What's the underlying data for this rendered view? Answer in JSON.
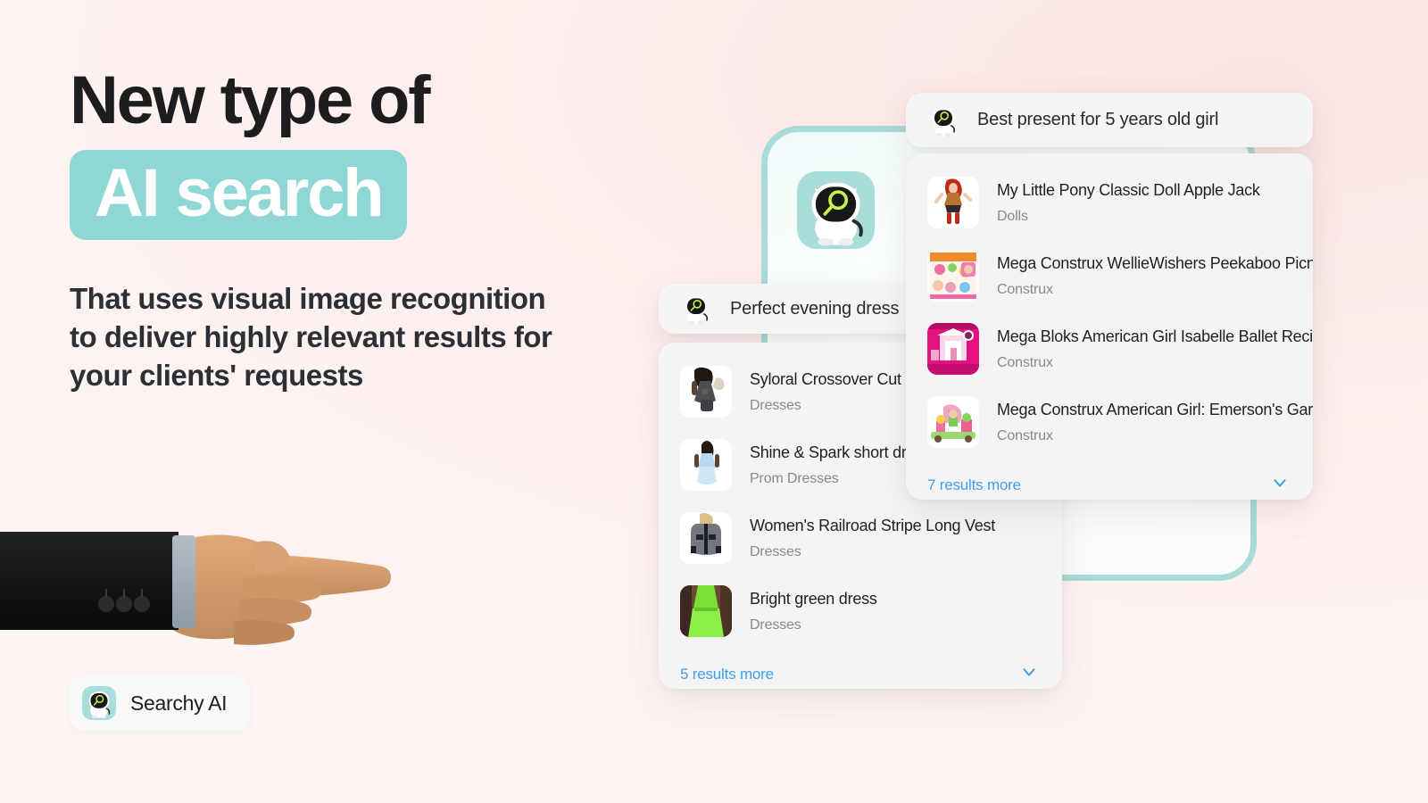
{
  "brand": {
    "name": "Searchy AI",
    "icon": "searchy-robot-icon",
    "accent_teal": "#a8ddd9",
    "accent_green": "#c6f04a",
    "background_pink": "#fdeceb"
  },
  "hero": {
    "headline_line1": "New type of",
    "headline_highlight": "AI search",
    "highlight_bg": "#8ed7d4",
    "subheadline": "That uses visual image recognition to deliver highly relevant results for your clients' requests",
    "pointer_icon": "pointing-hand-right-icon"
  },
  "cards": [
    {
      "id": "evening-dress",
      "query": "Perfect evening dress",
      "query_icon": "searchy-robot-icon",
      "results": [
        {
          "title": "Syloral Crossover Cut Out Fro",
          "category": "Dresses",
          "thumb": "thumbnail-sequin-dress"
        },
        {
          "title": "Shine & Spark short dress",
          "category": "Prom Dresses",
          "thumb": "thumbnail-blue-dress"
        },
        {
          "title": "Women's Railroad Stripe Long Vest",
          "category": "Dresses",
          "thumb": "thumbnail-grey-vest"
        },
        {
          "title": "Bright green dress",
          "category": "Dresses",
          "thumb": "thumbnail-green-dress"
        }
      ],
      "more_label": "5 results more",
      "more_icon": "chevron-down-icon"
    },
    {
      "id": "best-present",
      "query": "Best present for 5 years old girl",
      "query_icon": "searchy-robot-icon",
      "results": [
        {
          "title": "My Little Pony Classic Doll Apple Jack",
          "category": "Dolls",
          "thumb": "thumbnail-pony-doll"
        },
        {
          "title": "Mega Construx WellieWishers Peekaboo Picnic",
          "category": "Construx",
          "thumb": "thumbnail-picnic-set"
        },
        {
          "title": "Mega Bloks American Girl Isabelle Ballet Recital",
          "category": "Construx",
          "thumb": "thumbnail-ballet-recital"
        },
        {
          "title": "Mega Construx American Girl: Emerson's Garden..",
          "category": "Construx",
          "thumb": "thumbnail-garden-set"
        }
      ],
      "more_label": "7 results more",
      "more_icon": "chevron-down-icon"
    }
  ],
  "device": {
    "robot_icon": "searchy-robot-icon",
    "frame_color": "#a9dbd9"
  }
}
